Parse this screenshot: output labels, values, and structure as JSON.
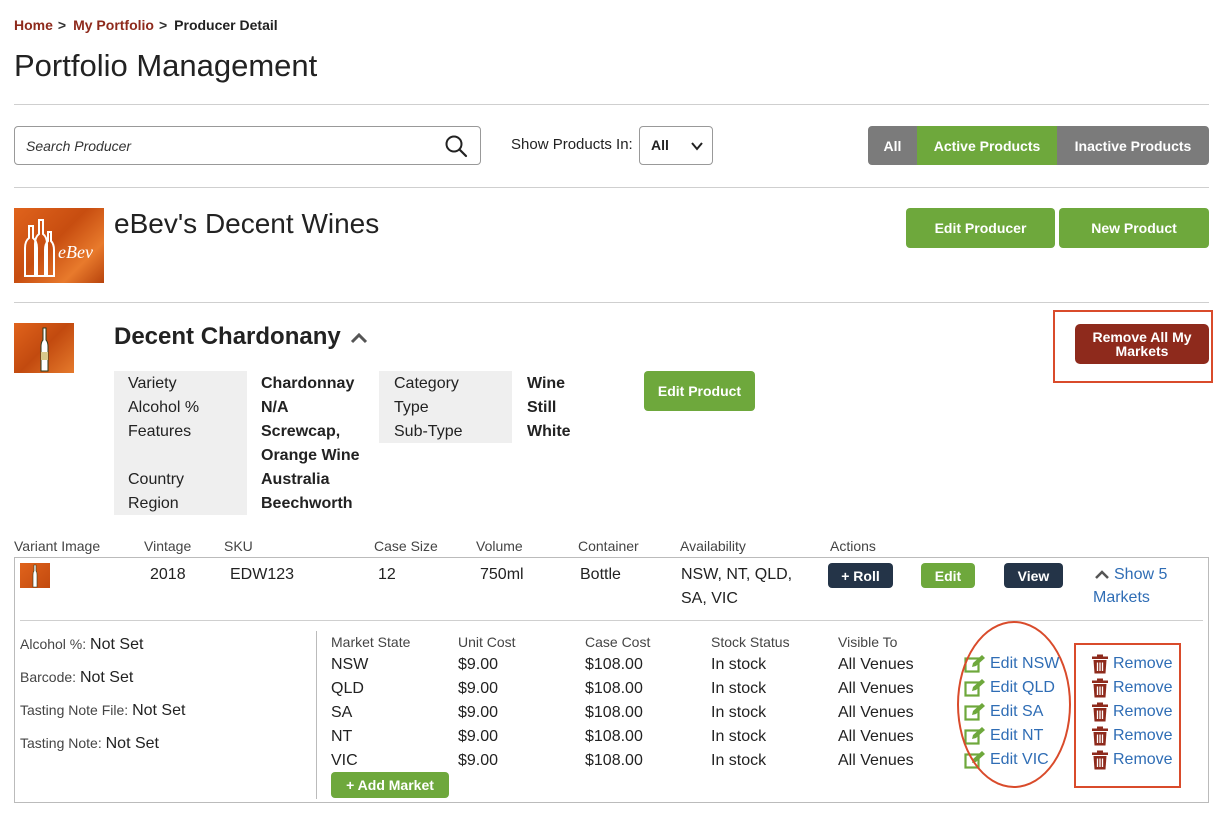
{
  "breadcrumb": {
    "home": "Home",
    "portfolio": "My Portfolio",
    "current": "Producer Detail",
    "sep": ">"
  },
  "page_title": "Portfolio Management",
  "search": {
    "placeholder": "Search Producer",
    "value": ""
  },
  "filter": {
    "label": "Show Products In:",
    "selected": "All"
  },
  "status_tabs": {
    "all": "All",
    "active": "Active Products",
    "inactive": "Inactive Products"
  },
  "producer": {
    "name": "eBev's Decent Wines",
    "logo_text": "eBev",
    "edit_label": "Edit Producer",
    "new_product_label": "New Product"
  },
  "product": {
    "name": "Decent Chardonany",
    "remove_all_line1": "Remove All My",
    "remove_all_line2": "Markets",
    "edit_label": "Edit Product",
    "attrs_left": [
      {
        "label": "Variety",
        "value": "Chardonnay"
      },
      {
        "label": "Alcohol %",
        "value": "N/A"
      },
      {
        "label": "Features",
        "value": "Screwcap,"
      },
      {
        "label": "",
        "value": "Orange Wine"
      },
      {
        "label": "Country",
        "value": "Australia"
      },
      {
        "label": "Region",
        "value": "Beechworth"
      }
    ],
    "attrs_right": [
      {
        "label": "Category",
        "value": "Wine"
      },
      {
        "label": "Type",
        "value": "Still"
      },
      {
        "label": "Sub-Type",
        "value": "White"
      }
    ]
  },
  "variant_table": {
    "headers": [
      "Variant Image",
      "Vintage",
      "SKU",
      "Case Size",
      "Volume",
      "Container",
      "Availability",
      "Actions"
    ],
    "row": {
      "vintage": "2018",
      "sku": "EDW123",
      "case_size": "12",
      "volume": "750ml",
      "container": "Bottle",
      "availability_line1": "NSW, NT, QLD,",
      "availability_line2": "SA, VIC",
      "roll_label": "+ Roll",
      "edit_label": "Edit",
      "view_label": "View",
      "show_markets_line1": "Show 5",
      "show_markets_line2": "Markets"
    }
  },
  "variant_meta": [
    {
      "label": "Alcohol %:",
      "value": "Not Set"
    },
    {
      "label": "Barcode:",
      "value": "Not Set"
    },
    {
      "label": "Tasting Note File:",
      "value": "Not Set"
    },
    {
      "label": "Tasting Note:",
      "value": "Not Set"
    }
  ],
  "markets": {
    "headers": [
      "Market State",
      "Unit Cost",
      "Case Cost",
      "Stock Status",
      "Visible To"
    ],
    "rows": [
      {
        "state": "NSW",
        "unit": "$9.00",
        "case": "$108.00",
        "stock": "In stock",
        "visible": "All Venues",
        "edit": "Edit NSW",
        "remove": "Remove"
      },
      {
        "state": "QLD",
        "unit": "$9.00",
        "case": "$108.00",
        "stock": "In stock",
        "visible": "All Venues",
        "edit": "Edit QLD",
        "remove": "Remove"
      },
      {
        "state": "SA",
        "unit": "$9.00",
        "case": "$108.00",
        "stock": "In stock",
        "visible": "All Venues",
        "edit": "Edit SA",
        "remove": "Remove"
      },
      {
        "state": "NT",
        "unit": "$9.00",
        "case": "$108.00",
        "stock": "In stock",
        "visible": "All Venues",
        "edit": "Edit NT",
        "remove": "Remove"
      },
      {
        "state": "VIC",
        "unit": "$9.00",
        "case": "$108.00",
        "stock": "In stock",
        "visible": "All Venues",
        "edit": "Edit VIC",
        "remove": "Remove"
      }
    ],
    "add_label": "+ Add Market"
  },
  "colors": {
    "brand_red": "#8e2a1c",
    "green": "#6ea83c",
    "navy": "#243448",
    "link": "#2f6db5",
    "annotation": "#d94b2b"
  },
  "icons": {
    "search": "search-icon",
    "edit": "edit-icon",
    "remove": "trash-icon",
    "caret": "chevron-up-icon",
    "select": "chevron-down-icon"
  }
}
